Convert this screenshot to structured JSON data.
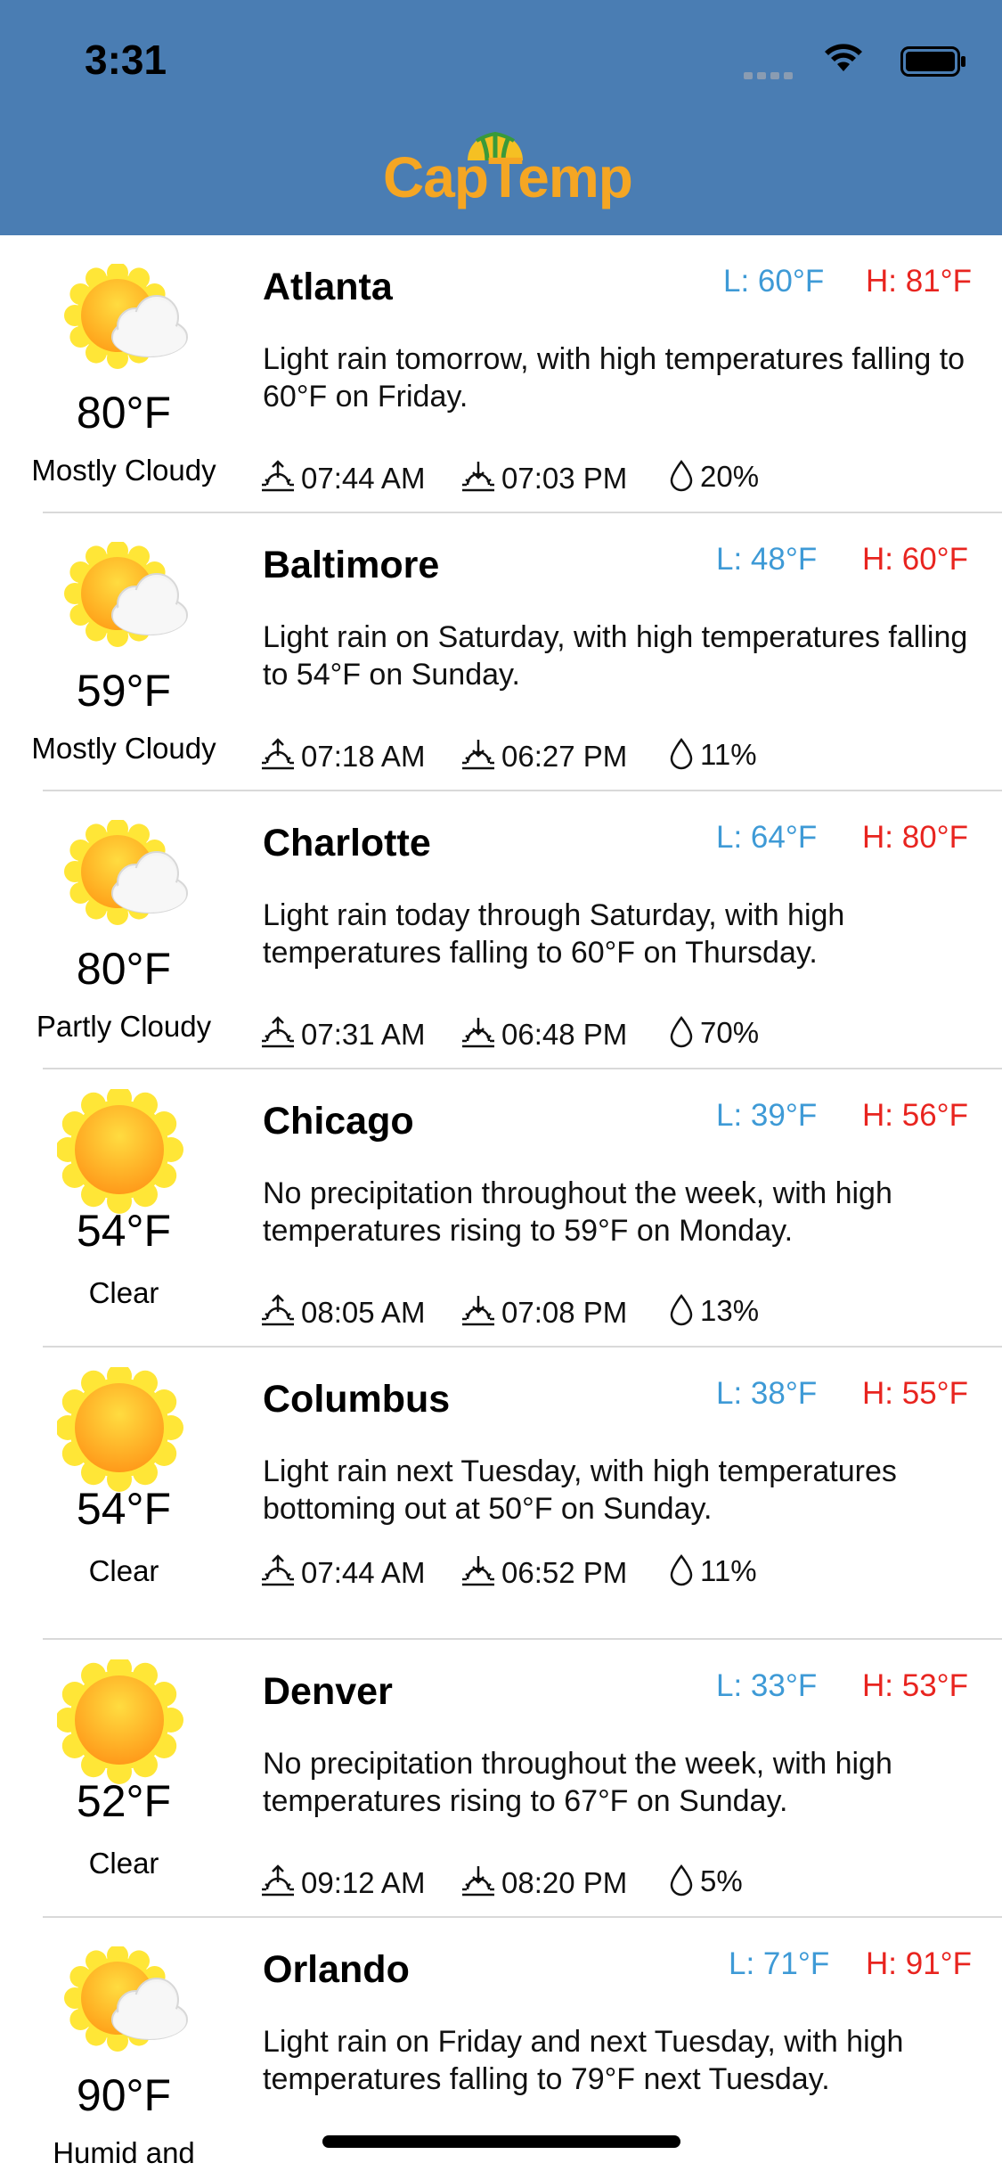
{
  "status_bar": {
    "time": "3:31"
  },
  "app": {
    "title": "CapTemp"
  },
  "cities": [
    {
      "name": "Atlanta",
      "temp": "80°F",
      "condition": "Mostly Cloudy",
      "icon": "partly-cloudy-icon",
      "low": "L: 60°F",
      "high": "H: 81°F",
      "summary": "Light rain tomorrow, with high temperatures falling to 60°F on Friday.",
      "sunrise": "07:44 AM",
      "sunset": "07:03 PM",
      "precip": "20%"
    },
    {
      "name": "Baltimore",
      "temp": "59°F",
      "condition": "Mostly Cloudy",
      "icon": "partly-cloudy-icon",
      "low": "L: 48°F",
      "high": "H: 60°F",
      "summary": "Light rain on Saturday, with high temperatures falling to 54°F on Sunday.",
      "sunrise": "07:18 AM",
      "sunset": "06:27 PM",
      "precip": "11%"
    },
    {
      "name": "Charlotte",
      "temp": "80°F",
      "condition": "Partly Cloudy",
      "icon": "partly-cloudy-icon",
      "low": "L: 64°F",
      "high": "H: 80°F",
      "summary": "Light rain today through Saturday, with high temperatures falling to 60°F on Thursday.",
      "sunrise": "07:31 AM",
      "sunset": "06:48 PM",
      "precip": "70%"
    },
    {
      "name": "Chicago",
      "temp": "54°F",
      "condition": "Clear",
      "icon": "sun-icon",
      "low": "L: 39°F",
      "high": "H: 56°F",
      "summary": "No precipitation throughout the week, with high temperatures rising to 59°F on Monday.",
      "sunrise": "08:05 AM",
      "sunset": "07:08 PM",
      "precip": "13%"
    },
    {
      "name": "Columbus",
      "temp": "54°F",
      "condition": "Clear",
      "icon": "sun-icon",
      "low": "L: 38°F",
      "high": "H: 55°F",
      "summary": "Light rain next Tuesday, with high temperatures bottoming out at 50°F on Sunday.",
      "sunrise": "07:44 AM",
      "sunset": "06:52 PM",
      "precip": "11%"
    },
    {
      "name": "Denver",
      "temp": "52°F",
      "condition": "Clear",
      "icon": "sun-icon",
      "low": "L: 33°F",
      "high": "H: 53°F",
      "summary": "No precipitation throughout the week, with high temperatures rising to 67°F on Sunday.",
      "sunrise": "09:12 AM",
      "sunset": "08:20 PM",
      "precip": "5%"
    },
    {
      "name": "Orlando",
      "temp": "90°F",
      "condition": "Humid and",
      "icon": "partly-cloudy-icon",
      "low": "L: 71°F",
      "high": "H: 91°F",
      "summary": "Light rain on Friday and next Tuesday, with high temperatures falling to 79°F next Tuesday.",
      "sunrise": "",
      "sunset": "",
      "precip": ""
    }
  ],
  "colors": {
    "header_bg": "#4a7db3",
    "low": "#3e9ad6",
    "high": "#e8241f",
    "logo": "#f5a623"
  }
}
